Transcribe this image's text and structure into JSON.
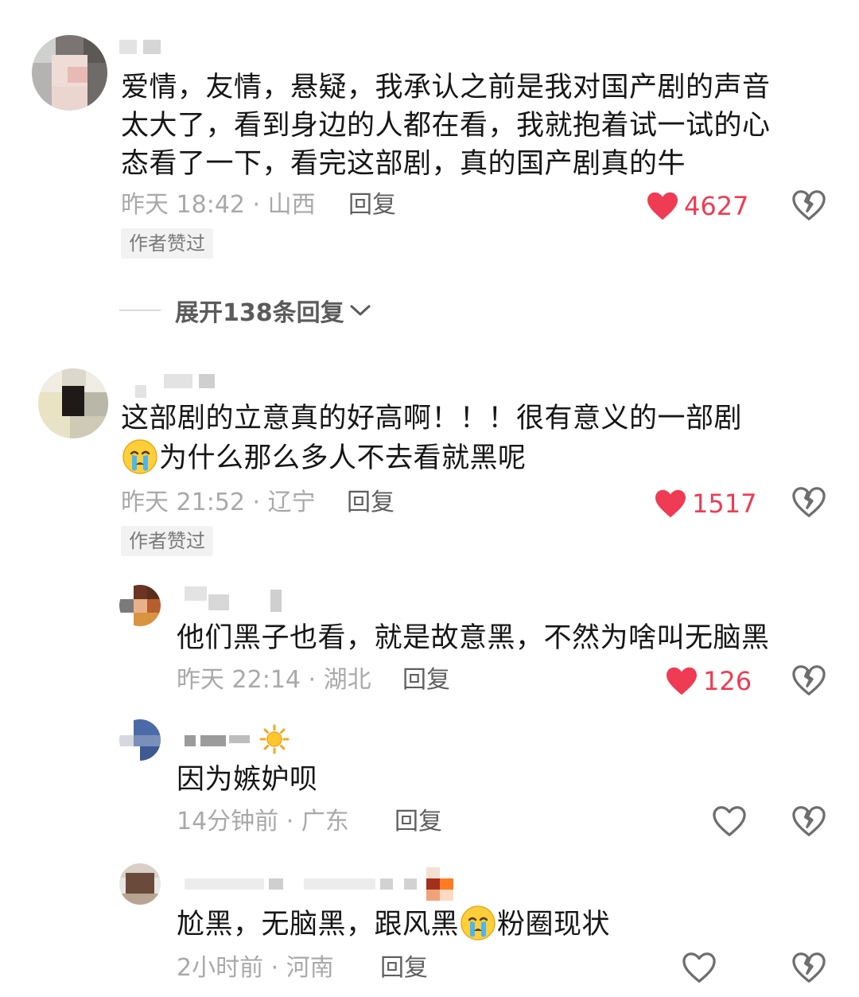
{
  "comments": [
    {
      "text_lines": [
        "爱情，友情，悬疑，我承认之前是我对国产剧的声音",
        "太大了，看到身边的人都在看，我就抱着试一试的心",
        "态看了一下，看完这部剧，真的国产剧真的牛"
      ],
      "meta": "昨天 18:42 · 山西",
      "reply_label": "回复",
      "likes": "4627",
      "liked": true,
      "badge": "作者赞过",
      "expand_label": "展开138条回复"
    },
    {
      "text_line1": "这部剧的立意真的好高啊！！！很有意义的一部剧",
      "text_line2_after_emoji": "为什么那么多人不去看就黑呢",
      "emoji": "crying-face",
      "meta": "昨天 21:52 · 辽宁",
      "reply_label": "回复",
      "likes": "1517",
      "liked": true,
      "badge": "作者赞过"
    }
  ],
  "replies": [
    {
      "text": "他们黑子也看，就是故意黑，不然为啥叫无脑黑",
      "meta": "昨天 22:14 · 湖北",
      "reply_label": "回复",
      "likes": "126",
      "liked": true
    },
    {
      "text": "因为嫉妒呗",
      "name_emoji": "sun",
      "meta": "14分钟前 · 广东",
      "reply_label": "回复",
      "likes": "",
      "liked": false
    },
    {
      "text_before_emoji": "尬黑，无脑黑，跟风黑",
      "text_after_emoji": "粉圈现状",
      "emoji": "crying-face",
      "meta": "2小时前 · 河南",
      "reply_label": "回复",
      "likes": "",
      "liked": false
    }
  ],
  "colors": {
    "like_red": "#ef3b53",
    "meta_gray": "#a9a9a9",
    "text": "#161616"
  },
  "icons": [
    "heart-icon",
    "broken-heart-icon",
    "chevron-down-icon",
    "crying-face-emoji",
    "sun-emoji"
  ]
}
